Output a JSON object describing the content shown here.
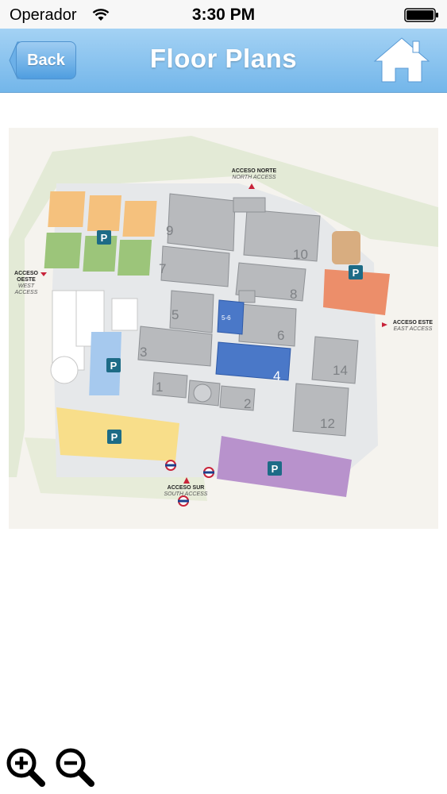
{
  "status_bar": {
    "carrier": "Operador",
    "time": "3:30 PM",
    "wifi_icon": "wifi-icon",
    "battery_icon": "battery-full-icon"
  },
  "nav": {
    "back_label": "Back",
    "title": "Floor Plans",
    "home_icon": "home-icon"
  },
  "map": {
    "halls": [
      "1",
      "2",
      "3",
      "4",
      "5",
      "5-6",
      "6",
      "7",
      "8",
      "9",
      "10",
      "12",
      "14"
    ],
    "parking_label": "P",
    "accesses": {
      "north": {
        "label": "ACCESO NORTE",
        "sub": "NORTH ACCESS"
      },
      "west": {
        "label": "ACCESO OESTE",
        "sub": "WEST ACCESS"
      },
      "east": {
        "label": "ACCESO ESTE",
        "sub": "EAST ACCESS"
      },
      "south": {
        "label": "ACCESO SUR",
        "sub": "SOUTH ACCESS"
      }
    },
    "colors": {
      "highlight_hall": "#4a78c8",
      "parking_purple": "#b892cc",
      "parking_yellow": "#f8de8a",
      "parking_orange": "#f5c17d",
      "parking_green": "#9cc57a",
      "parking_coral": "#ec8e6a",
      "parking_tan": "#d8ad80",
      "parking_blue": "#a6c9ee",
      "parking_sign": "#1d6b86"
    }
  },
  "zoom": {
    "zoom_in_icon": "zoom-in-icon",
    "zoom_out_icon": "zoom-out-icon"
  }
}
